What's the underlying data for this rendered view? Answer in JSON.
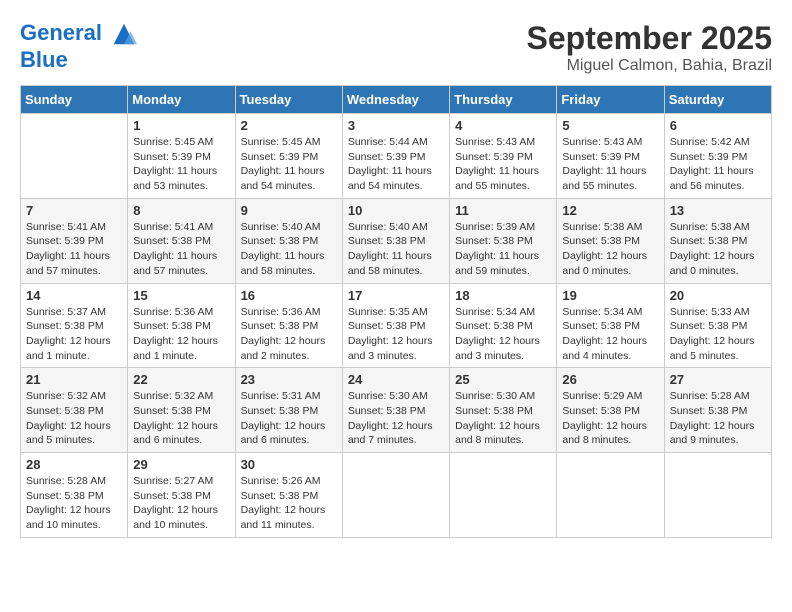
{
  "header": {
    "logo_line1": "General",
    "logo_line2": "Blue",
    "month": "September 2025",
    "location": "Miguel Calmon, Bahia, Brazil"
  },
  "days_of_week": [
    "Sunday",
    "Monday",
    "Tuesday",
    "Wednesday",
    "Thursday",
    "Friday",
    "Saturday"
  ],
  "weeks": [
    [
      {
        "day": "",
        "info": ""
      },
      {
        "day": "1",
        "info": "Sunrise: 5:45 AM\nSunset: 5:39 PM\nDaylight: 11 hours\nand 53 minutes."
      },
      {
        "day": "2",
        "info": "Sunrise: 5:45 AM\nSunset: 5:39 PM\nDaylight: 11 hours\nand 54 minutes."
      },
      {
        "day": "3",
        "info": "Sunrise: 5:44 AM\nSunset: 5:39 PM\nDaylight: 11 hours\nand 54 minutes."
      },
      {
        "day": "4",
        "info": "Sunrise: 5:43 AM\nSunset: 5:39 PM\nDaylight: 11 hours\nand 55 minutes."
      },
      {
        "day": "5",
        "info": "Sunrise: 5:43 AM\nSunset: 5:39 PM\nDaylight: 11 hours\nand 55 minutes."
      },
      {
        "day": "6",
        "info": "Sunrise: 5:42 AM\nSunset: 5:39 PM\nDaylight: 11 hours\nand 56 minutes."
      }
    ],
    [
      {
        "day": "7",
        "info": "Sunrise: 5:41 AM\nSunset: 5:39 PM\nDaylight: 11 hours\nand 57 minutes."
      },
      {
        "day": "8",
        "info": "Sunrise: 5:41 AM\nSunset: 5:38 PM\nDaylight: 11 hours\nand 57 minutes."
      },
      {
        "day": "9",
        "info": "Sunrise: 5:40 AM\nSunset: 5:38 PM\nDaylight: 11 hours\nand 58 minutes."
      },
      {
        "day": "10",
        "info": "Sunrise: 5:40 AM\nSunset: 5:38 PM\nDaylight: 11 hours\nand 58 minutes."
      },
      {
        "day": "11",
        "info": "Sunrise: 5:39 AM\nSunset: 5:38 PM\nDaylight: 11 hours\nand 59 minutes."
      },
      {
        "day": "12",
        "info": "Sunrise: 5:38 AM\nSunset: 5:38 PM\nDaylight: 12 hours\nand 0 minutes."
      },
      {
        "day": "13",
        "info": "Sunrise: 5:38 AM\nSunset: 5:38 PM\nDaylight: 12 hours\nand 0 minutes."
      }
    ],
    [
      {
        "day": "14",
        "info": "Sunrise: 5:37 AM\nSunset: 5:38 PM\nDaylight: 12 hours\nand 1 minute."
      },
      {
        "day": "15",
        "info": "Sunrise: 5:36 AM\nSunset: 5:38 PM\nDaylight: 12 hours\nand 1 minute."
      },
      {
        "day": "16",
        "info": "Sunrise: 5:36 AM\nSunset: 5:38 PM\nDaylight: 12 hours\nand 2 minutes."
      },
      {
        "day": "17",
        "info": "Sunrise: 5:35 AM\nSunset: 5:38 PM\nDaylight: 12 hours\nand 3 minutes."
      },
      {
        "day": "18",
        "info": "Sunrise: 5:34 AM\nSunset: 5:38 PM\nDaylight: 12 hours\nand 3 minutes."
      },
      {
        "day": "19",
        "info": "Sunrise: 5:34 AM\nSunset: 5:38 PM\nDaylight: 12 hours\nand 4 minutes."
      },
      {
        "day": "20",
        "info": "Sunrise: 5:33 AM\nSunset: 5:38 PM\nDaylight: 12 hours\nand 5 minutes."
      }
    ],
    [
      {
        "day": "21",
        "info": "Sunrise: 5:32 AM\nSunset: 5:38 PM\nDaylight: 12 hours\nand 5 minutes."
      },
      {
        "day": "22",
        "info": "Sunrise: 5:32 AM\nSunset: 5:38 PM\nDaylight: 12 hours\nand 6 minutes."
      },
      {
        "day": "23",
        "info": "Sunrise: 5:31 AM\nSunset: 5:38 PM\nDaylight: 12 hours\nand 6 minutes."
      },
      {
        "day": "24",
        "info": "Sunrise: 5:30 AM\nSunset: 5:38 PM\nDaylight: 12 hours\nand 7 minutes."
      },
      {
        "day": "25",
        "info": "Sunrise: 5:30 AM\nSunset: 5:38 PM\nDaylight: 12 hours\nand 8 minutes."
      },
      {
        "day": "26",
        "info": "Sunrise: 5:29 AM\nSunset: 5:38 PM\nDaylight: 12 hours\nand 8 minutes."
      },
      {
        "day": "27",
        "info": "Sunrise: 5:28 AM\nSunset: 5:38 PM\nDaylight: 12 hours\nand 9 minutes."
      }
    ],
    [
      {
        "day": "28",
        "info": "Sunrise: 5:28 AM\nSunset: 5:38 PM\nDaylight: 12 hours\nand 10 minutes."
      },
      {
        "day": "29",
        "info": "Sunrise: 5:27 AM\nSunset: 5:38 PM\nDaylight: 12 hours\nand 10 minutes."
      },
      {
        "day": "30",
        "info": "Sunrise: 5:26 AM\nSunset: 5:38 PM\nDaylight: 12 hours\nand 11 minutes."
      },
      {
        "day": "",
        "info": ""
      },
      {
        "day": "",
        "info": ""
      },
      {
        "day": "",
        "info": ""
      },
      {
        "day": "",
        "info": ""
      }
    ]
  ]
}
